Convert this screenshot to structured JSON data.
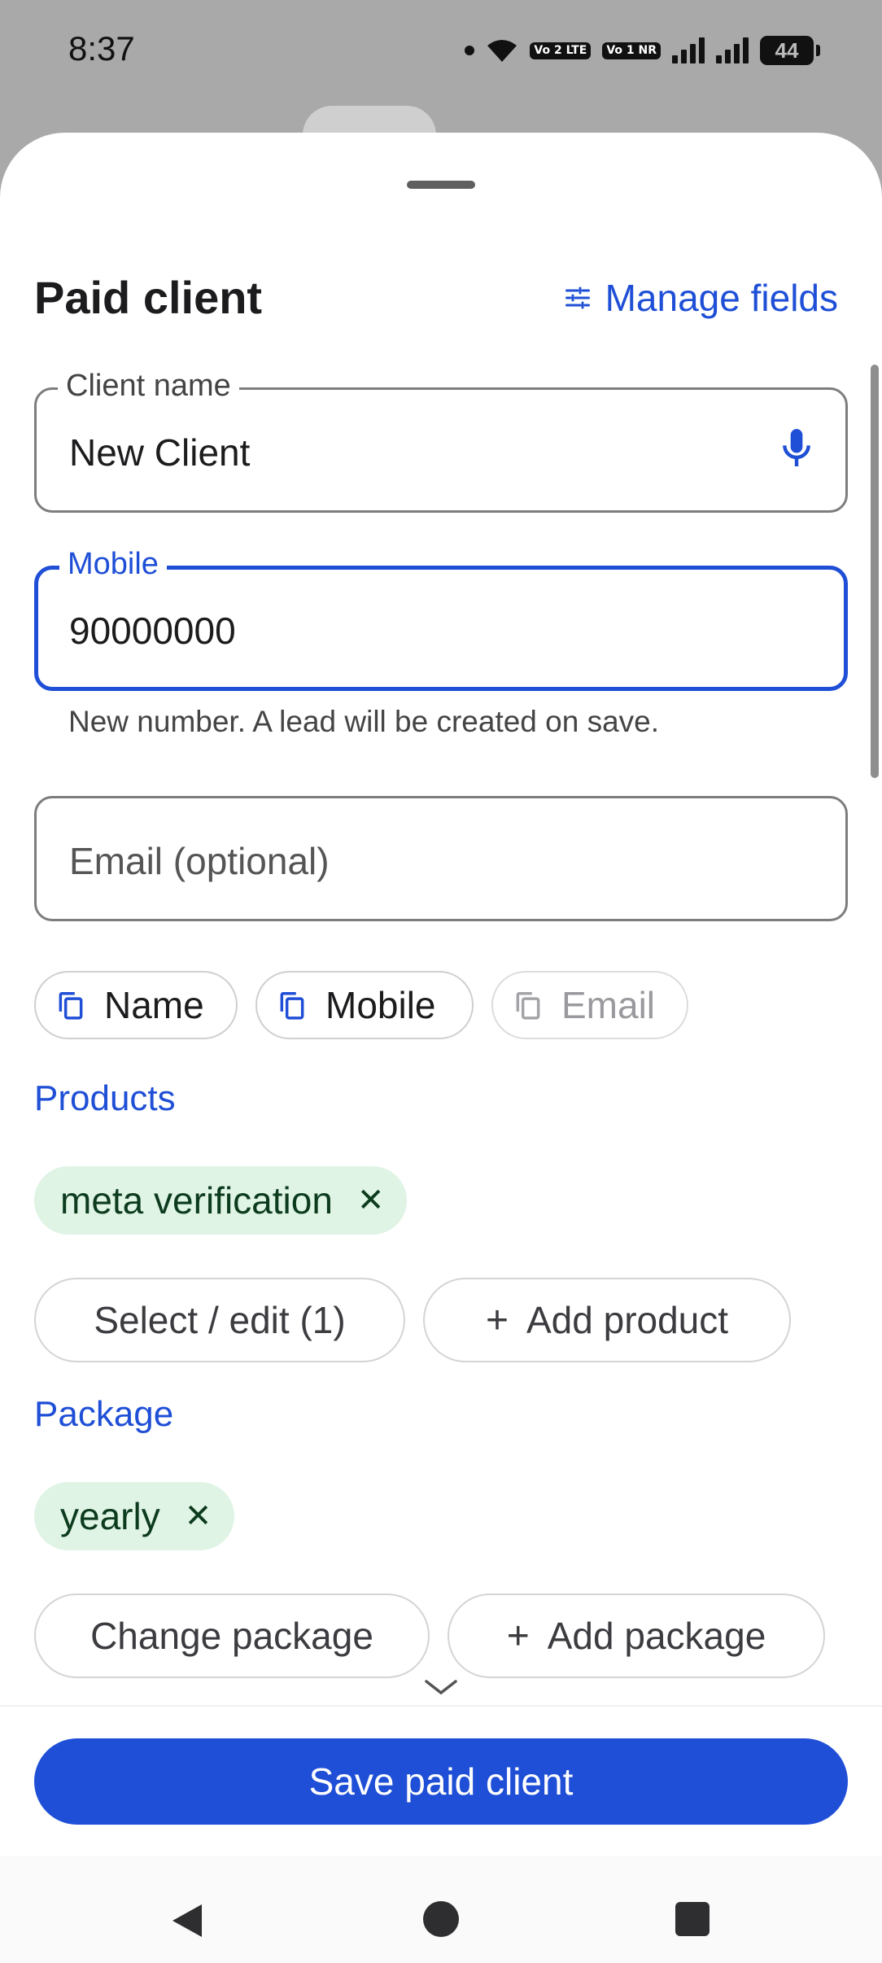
{
  "status": {
    "time": "8:37",
    "battery": "44",
    "sim1": "Vo 2 LTE",
    "sim2": "Vo 1 NR"
  },
  "header": {
    "title": "Paid client",
    "manage_fields": "Manage fields"
  },
  "form": {
    "client_name": {
      "label": "Client name",
      "value": "New Client"
    },
    "mobile": {
      "label": "Mobile",
      "value": "90000000",
      "helper": "New number. A lead will be created on save."
    },
    "email": {
      "placeholder": "Email (optional)"
    }
  },
  "copy_chips": {
    "name": "Name",
    "mobile": "Mobile",
    "email": "Email"
  },
  "products": {
    "heading": "Products",
    "tags": [
      "meta verification"
    ],
    "select_button": "Select / edit (1)",
    "add_button": "Add product"
  },
  "package": {
    "heading": "Package",
    "tags": [
      "yearly"
    ],
    "change_button": "Change package",
    "add_button": "Add package"
  },
  "footer": {
    "save_button": "Save paid client"
  },
  "icons": {
    "manage": "tune-icon",
    "mic": "mic-icon",
    "copy": "copy-icon",
    "remove": "close-icon",
    "add": "plus-icon",
    "more": "chevron-down-icon"
  },
  "colors": {
    "accent": "#1f4fd6",
    "tag_bg": "#dff4e5",
    "tag_text": "#0d3b1e"
  }
}
